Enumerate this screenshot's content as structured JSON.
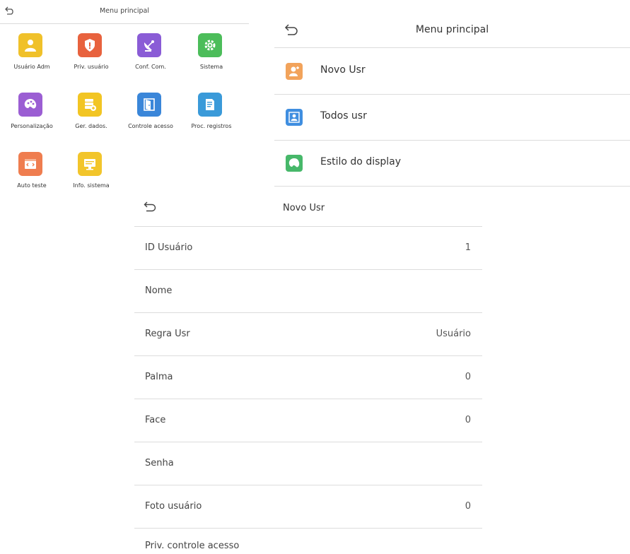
{
  "grid_menu": {
    "title": "Menu principal",
    "tiles": [
      {
        "label": "Usuário Adm",
        "icon": "admin-user-icon",
        "color": "#f0c12a"
      },
      {
        "label": "Priv. usuário",
        "icon": "shield-icon",
        "color": "#e8623e"
      },
      {
        "label": "Conf. Com.",
        "icon": "satellite-dish-icon",
        "color": "#8a5cd6"
      },
      {
        "label": "Sistema",
        "icon": "gear-icon",
        "color": "#4cbd5a"
      },
      {
        "label": "Personalização",
        "icon": "palette-icon",
        "color": "#9b5ed3"
      },
      {
        "label": "Ger. dados.",
        "icon": "database-icon",
        "color": "#f2c523"
      },
      {
        "label": "Controle acesso",
        "icon": "door-icon",
        "color": "#3a86d9"
      },
      {
        "label": "Proc. registros",
        "icon": "document-search-icon",
        "color": "#3a9ad9"
      },
      {
        "label": "Auto teste",
        "icon": "code-icon",
        "color": "#ef7d4f"
      },
      {
        "label": "Info. sistema",
        "icon": "monitor-icon",
        "color": "#f2c52b"
      }
    ]
  },
  "list_menu": {
    "title": "Menu principal",
    "items": [
      {
        "label": "Novo Usr",
        "icon": "add-user-icon",
        "color": "#f2a35b"
      },
      {
        "label": "Todos usr",
        "icon": "user-list-icon",
        "color": "#3f8ee0"
      },
      {
        "label": "Estilo do display",
        "icon": "display-style-icon",
        "color": "#47b86a"
      }
    ]
  },
  "new_user": {
    "title": "Novo Usr",
    "fields": [
      {
        "label": "ID Usuário",
        "value": "1"
      },
      {
        "label": "Nome",
        "value": ""
      },
      {
        "label": "Regra Usr",
        "value": "Usuário"
      },
      {
        "label": "Palma",
        "value": "0"
      },
      {
        "label": "Face",
        "value": "0"
      },
      {
        "label": "Senha",
        "value": ""
      },
      {
        "label": "Foto usuário",
        "value": "0"
      },
      {
        "label": "Priv. controle acesso",
        "value": ""
      }
    ]
  }
}
